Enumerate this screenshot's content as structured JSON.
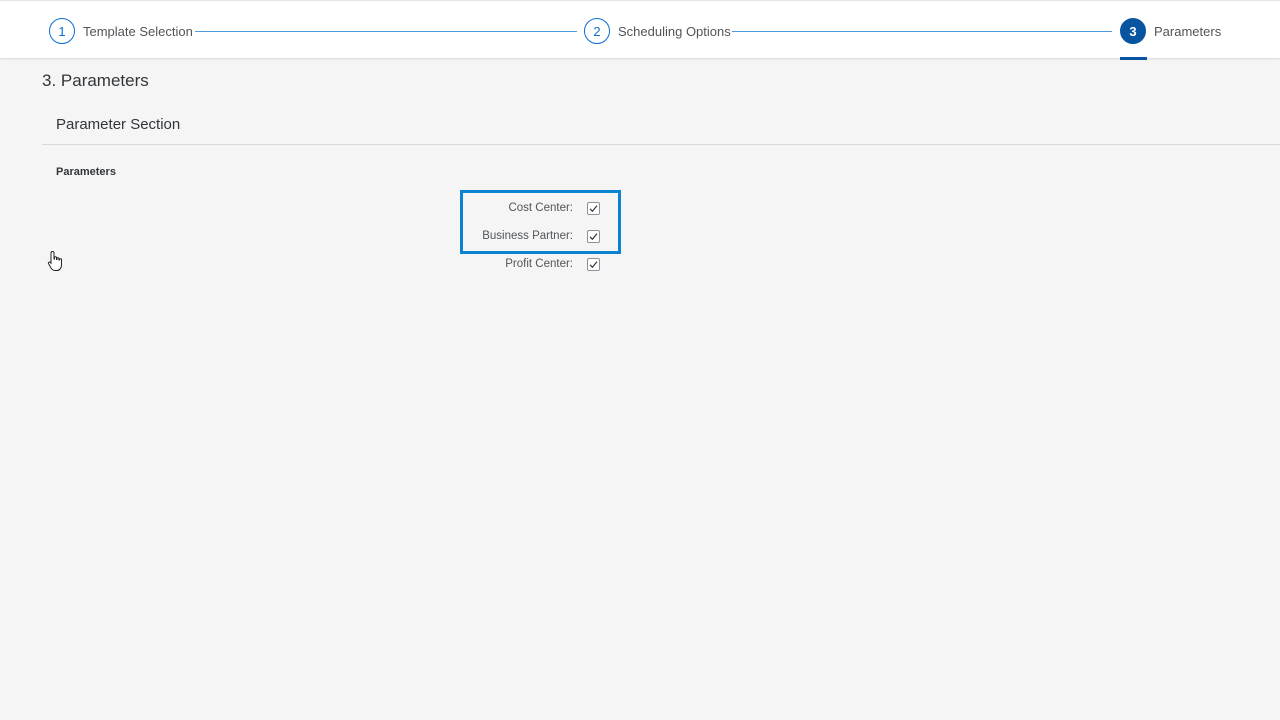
{
  "wizard": {
    "steps": [
      {
        "number": "1",
        "label": "Template Selection"
      },
      {
        "number": "2",
        "label": "Scheduling Options"
      },
      {
        "number": "3",
        "label": "Parameters"
      }
    ],
    "active_step": 3
  },
  "page": {
    "title": "3. Parameters",
    "section_title": "Parameter Section",
    "group_title": "Parameters"
  },
  "parameters": [
    {
      "label": "Cost Center:",
      "checked": true
    },
    {
      "label": "Business Partner:",
      "checked": true
    },
    {
      "label": "Profit Center:",
      "checked": true
    }
  ],
  "colors": {
    "accent": "#0a6ed1",
    "active_step": "#0854a0",
    "highlight": "#0a84d0",
    "background": "#f5f5f5"
  }
}
